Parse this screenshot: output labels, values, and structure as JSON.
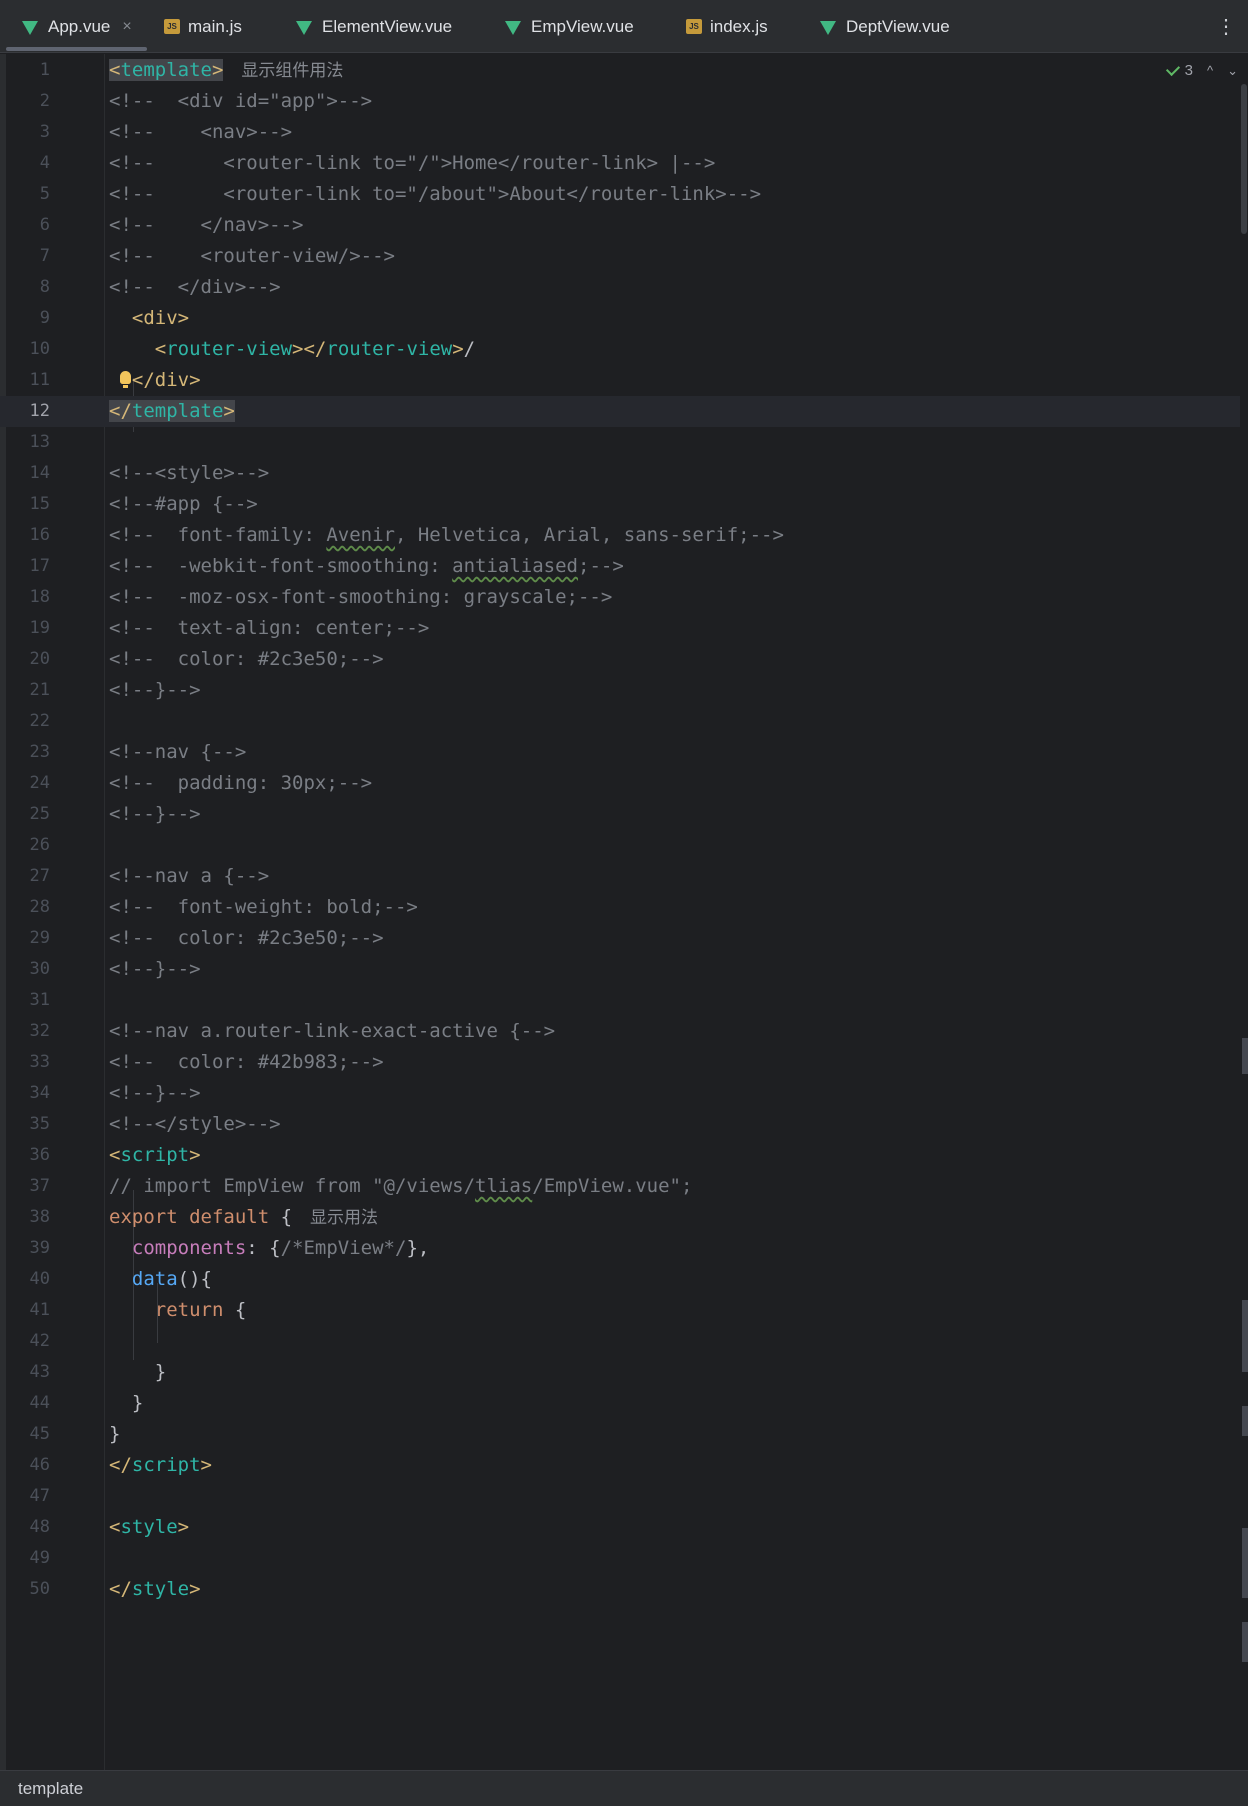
{
  "tabs": [
    {
      "label": "App.vue",
      "type": "vue",
      "active": true
    },
    {
      "label": "main.js",
      "type": "js",
      "active": false
    },
    {
      "label": "ElementView.vue",
      "type": "vue",
      "active": false
    },
    {
      "label": "EmpView.vue",
      "type": "vue",
      "active": false
    },
    {
      "label": "index.js",
      "type": "js",
      "active": false
    },
    {
      "label": "DeptView.vue",
      "type": "vue",
      "active": false
    }
  ],
  "tab_icons": {
    "vue": "vue-icon",
    "js": "js-icon",
    "close": "close-icon",
    "menu": "more-vertical-icon"
  },
  "tab_menu_glyph": "⋮",
  "close_glyph": "×",
  "inspections": {
    "count": "3",
    "up": "^",
    "down": "⌄"
  },
  "hints": {
    "component_usage": "显示组件用法",
    "usage": "显示用法"
  },
  "current_line": 12,
  "lines": {
    "1_a": "<",
    "1_b": "template",
    "1_c": ">",
    "2": "<!--  <div id=\"app\">-->",
    "3": "<!--    <nav>-->",
    "4": "<!--      <router-link to=\"/\">Home</router-link> |-->",
    "5": "<!--      <router-link to=\"/about\">About</router-link>-->",
    "6": "<!--    </nav>-->",
    "7": "<!--    <router-view/>-->",
    "8": "<!--  </div>-->",
    "9_a": "  <div>",
    "10_a": "    <",
    "10_b": "router-view",
    "10_c": "></",
    "10_d": "router-view",
    "10_e": ">",
    "10_f": "/",
    "11_a": "  ",
    "11_b": "</div>",
    "12_a": "</",
    "12_b": "template",
    "12_c": ">",
    "14": "<!--<style>-->",
    "15": "<!--#app {-->",
    "16_a": "<!--  font-family: ",
    "16_b": "Avenir",
    "16_c": ", Helvetica, Arial, sans-serif;-->",
    "17_a": "<!--  -webkit-font-smoothing: ",
    "17_b": "antialiased",
    "17_c": ";-->",
    "18": "<!--  -moz-osx-font-smoothing: grayscale;-->",
    "19": "<!--  text-align: center;-->",
    "20": "<!--  color: #2c3e50;-->",
    "21": "<!--}-->",
    "23": "<!--nav {-->",
    "24": "<!--  padding: 30px;-->",
    "25": "<!--}-->",
    "27": "<!--nav a {-->",
    "28": "<!--  font-weight: bold;-->",
    "29": "<!--  color: #2c3e50;-->",
    "30": "<!--}-->",
    "32": "<!--nav a.router-link-exact-active {-->",
    "33": "<!--  color: #42b983;-->",
    "34": "<!--}-->",
    "35": "<!--</style>-->",
    "36_a": "<",
    "36_b": "script",
    "36_c": ">",
    "37_a": "// import EmpView from \"@/views/",
    "37_b": "tlias",
    "37_c": "/EmpView.vue\";",
    "38_a": "export default",
    "38_b": " {",
    "39_a": "  ",
    "39_b": "components",
    "39_c": ": {",
    "39_d": "/*EmpView*/",
    "39_e": "},",
    "40_a": "  ",
    "40_b": "data",
    "40_c": "(){",
    "41_a": "    ",
    "41_b": "return",
    "41_c": " {",
    "43": "    }",
    "44": "  }",
    "45": "}",
    "46_a": "</",
    "46_b": "script",
    "46_c": ">",
    "48_a": "<",
    "48_b": "style",
    "48_c": ">",
    "50_a": "</",
    "50_b": "style",
    "50_c": ">"
  },
  "status_bar": {
    "breadcrumb": "template"
  }
}
